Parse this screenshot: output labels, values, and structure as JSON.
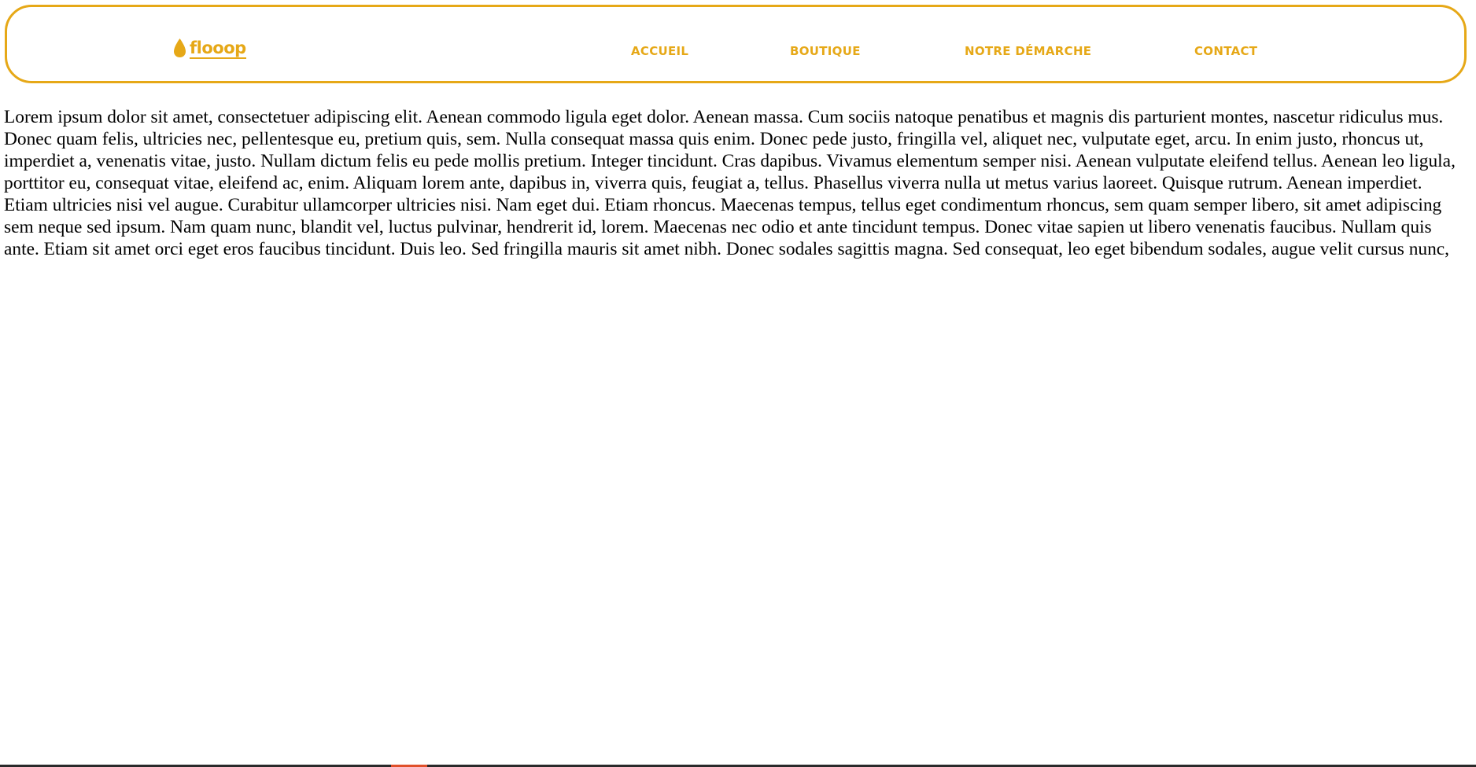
{
  "colors": {
    "brand": "#e6a817",
    "text": "#000000",
    "background": "#ffffff"
  },
  "header": {
    "logo": {
      "text": "flooop",
      "icon": "drop-icon"
    },
    "nav": {
      "accueil": "ACCUEIL",
      "boutique": "BOUTIQUE",
      "demarche": "NOTRE DÉMARCHE",
      "contact": "CONTACT"
    }
  },
  "main": {
    "paragraph": "Lorem ipsum dolor sit amet, consectetuer adipiscing elit. Aenean commodo ligula eget dolor. Aenean massa. Cum sociis natoque penatibus et magnis dis parturient montes, nascetur ridiculus mus. Donec quam felis, ultricies nec, pellentesque eu, pretium quis, sem. Nulla consequat massa quis enim. Donec pede justo, fringilla vel, aliquet nec, vulputate eget, arcu. In enim justo, rhoncus ut, imperdiet a, venenatis vitae, justo. Nullam dictum felis eu pede mollis pretium. Integer tincidunt. Cras dapibus. Vivamus elementum semper nisi. Aenean vulputate eleifend tellus. Aenean leo ligula, porttitor eu, consequat vitae, eleifend ac, enim. Aliquam lorem ante, dapibus in, viverra quis, feugiat a, tellus. Phasellus viverra nulla ut metus varius laoreet. Quisque rutrum. Aenean imperdiet. Etiam ultricies nisi vel augue. Curabitur ullamcorper ultricies nisi. Nam eget dui. Etiam rhoncus. Maecenas tempus, tellus eget condimentum rhoncus, sem quam semper libero, sit amet adipiscing sem neque sed ipsum. Nam quam nunc, blandit vel, luctus pulvinar, hendrerit id, lorem. Maecenas nec odio et ante tincidunt tempus. Donec vitae sapien ut libero venenatis faucibus. Nullam quis ante. Etiam sit amet orci eget eros faucibus tincidunt. Duis leo. Sed fringilla mauris sit amet nibh. Donec sodales sagittis magna. Sed consequat, leo eget bibendum sodales, augue velit cursus nunc,"
  }
}
